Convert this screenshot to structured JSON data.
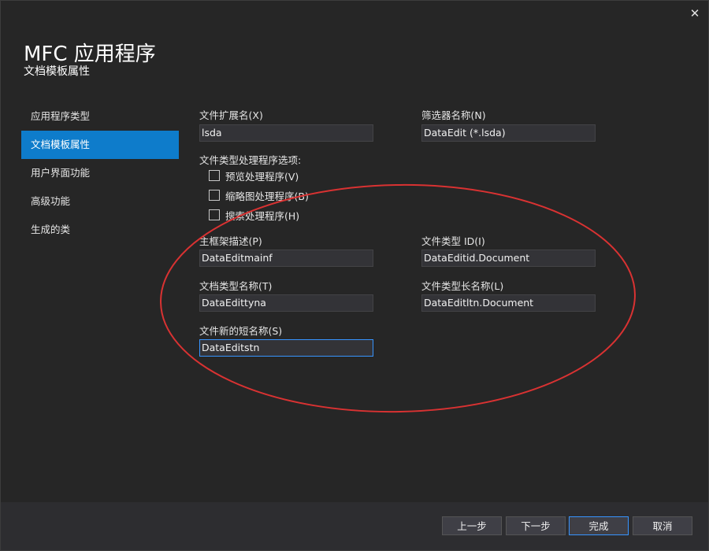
{
  "window": {
    "close_glyph": "✕"
  },
  "header": {
    "title": "MFC 应用程序",
    "subtitle": "文档模板属性"
  },
  "sidebar": {
    "items": [
      {
        "label": "应用程序类型",
        "active": false
      },
      {
        "label": "文档模板属性",
        "active": true
      },
      {
        "label": "用户界面功能",
        "active": false
      },
      {
        "label": "高级功能",
        "active": false
      },
      {
        "label": "生成的类",
        "active": false
      }
    ]
  },
  "form": {
    "file_extension": {
      "label": "文件扩展名(X)",
      "value": "lsda"
    },
    "filter_name": {
      "label": "筛选器名称(N)",
      "value": "DataEdit (*.lsda)"
    },
    "handler_options": {
      "label": "文件类型处理程序选项:",
      "preview": {
        "label": "预览处理程序(V)",
        "checked": false
      },
      "thumbnail": {
        "label": "缩略图处理程序(B)",
        "checked": false
      },
      "search": {
        "label": "搜索处理程序(H)",
        "checked": false
      }
    },
    "main_frame_caption": {
      "label": "主框架描述(P)",
      "value": "DataEditmainf"
    },
    "file_type_id": {
      "label": "文件类型 ID(I)",
      "value": "DataEditid.Document"
    },
    "doc_type_name": {
      "label": "文档类型名称(T)",
      "value": "DataEdittyna"
    },
    "file_type_long_name": {
      "label": "文件类型长名称(L)",
      "value": "DataEditltn.Document"
    },
    "file_new_short_name": {
      "label": "文件新的短名称(S)",
      "value": "DataEditstn"
    }
  },
  "annotation": {
    "color": "#d93232"
  },
  "footer": {
    "prev_label": "上一步",
    "next_label": "下一步",
    "finish_label": "完成",
    "cancel_label": "取消"
  },
  "colors": {
    "background": "#262626",
    "accent": "#0e7ccb",
    "field_bg": "#333337",
    "focus": "#3794ff"
  }
}
